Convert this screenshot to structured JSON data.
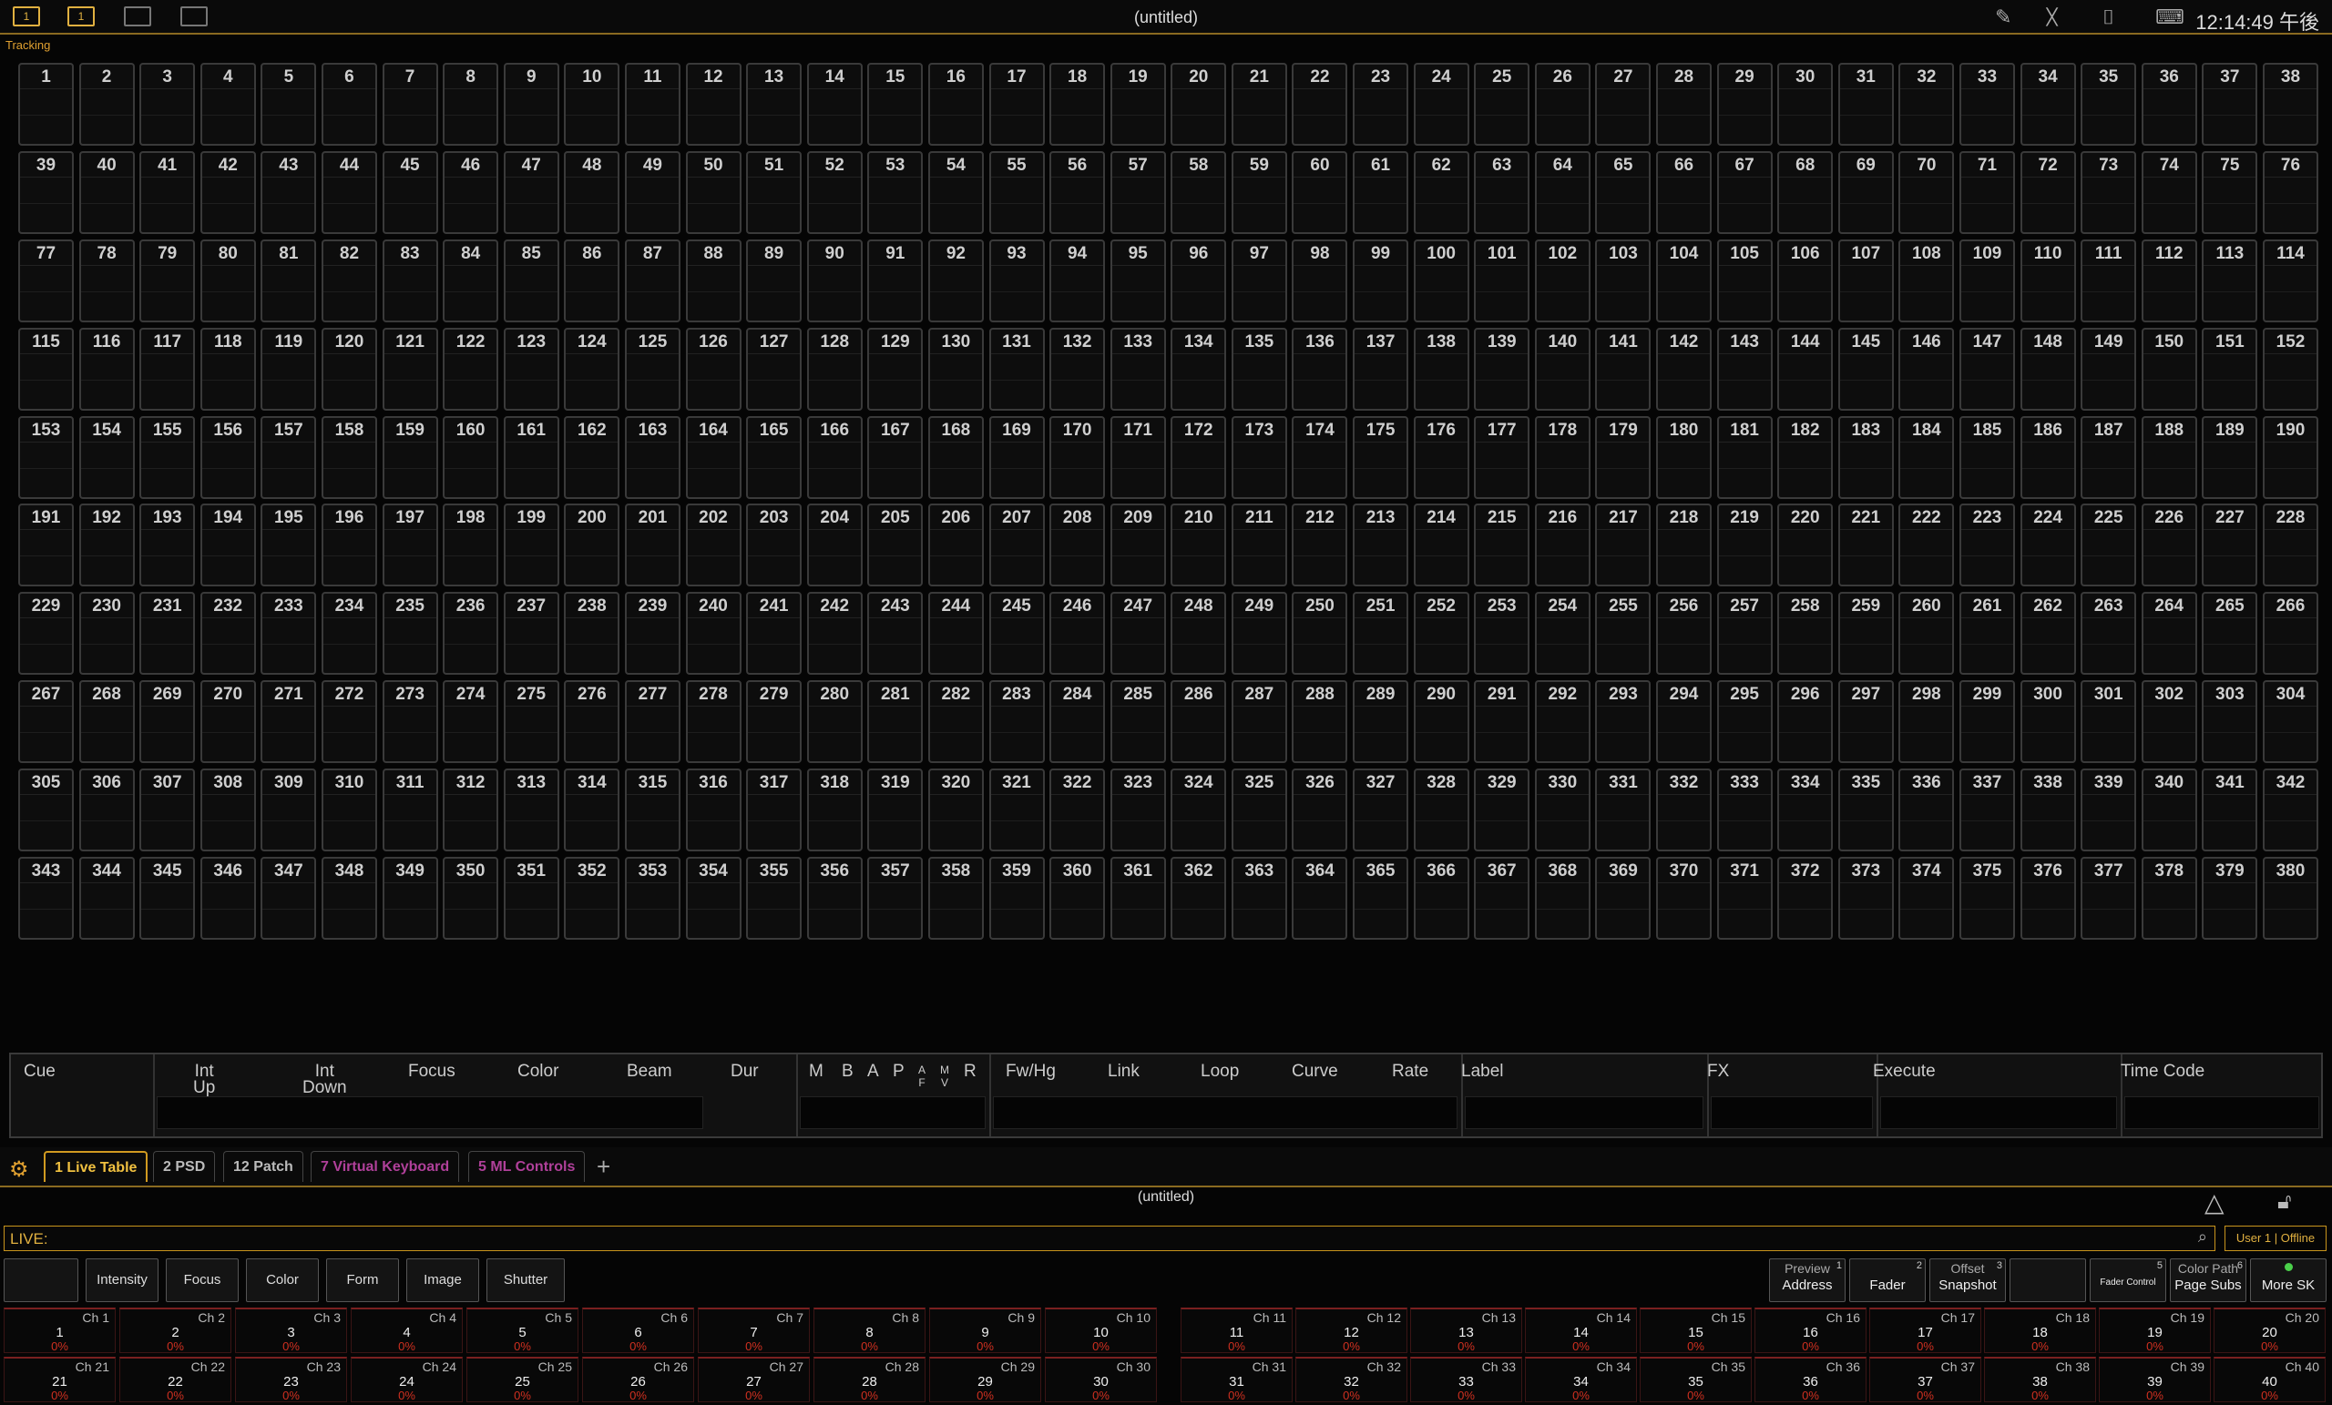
{
  "topbar": {
    "workspace_buttons": [
      "1",
      "1",
      "",
      ""
    ],
    "title": "(untitled)",
    "clock": "12:14:49 午後"
  },
  "grid": {
    "label": "Tracking",
    "channel_count": 380
  },
  "cuebar": {
    "headers": {
      "cue": "Cue",
      "int_up": "Int\nUp",
      "int_down": "Int\nDown",
      "focus": "Focus",
      "color": "Color",
      "beam": "Beam",
      "dur": "Dur",
      "m": "M",
      "b": "B",
      "a": "A",
      "p": "P",
      "af": "A\nF",
      "mv": "M\nV",
      "r": "R",
      "fwhg": "Fw/Hg",
      "link": "Link",
      "loop": "Loop",
      "curve": "Curve",
      "rate": "Rate",
      "label": "Label",
      "fx": "FX",
      "execute": "Execute",
      "time_code": "Time Code"
    }
  },
  "tabs": [
    {
      "label": "1 Live Table",
      "style": "active"
    },
    {
      "label": "2 PSD",
      "style": "normal"
    },
    {
      "label": "12 Patch",
      "style": "normal"
    },
    {
      "label": "7 Virtual Keyboard",
      "style": "magenta"
    },
    {
      "label": "5 ML Controls",
      "style": "magenta"
    }
  ],
  "tab_add": "+",
  "command": {
    "title": "(untitled)",
    "prompt": "LIVE:",
    "user_status": "User 1 | Offline"
  },
  "softkeys_left": [
    "",
    "Intensity",
    "Focus",
    "Color",
    "Form",
    "Image",
    "Shutter"
  ],
  "softkeys_right": [
    {
      "top": "Preview",
      "bottom": "Address",
      "num": "1"
    },
    {
      "top": "",
      "bottom": "Fader",
      "num": "2"
    },
    {
      "top": "Offset",
      "bottom": "Snapshot",
      "num": "3"
    },
    {
      "top": "",
      "bottom": "",
      "num": ""
    },
    {
      "top": "",
      "bottom": "Fader Control",
      "num": "5"
    },
    {
      "top": "Color Path",
      "bottom": "Page Subs",
      "num": "6"
    },
    {
      "top": "",
      "bottom": "More SK",
      "num": ""
    }
  ],
  "faders": {
    "count": 40,
    "value": "0%"
  }
}
